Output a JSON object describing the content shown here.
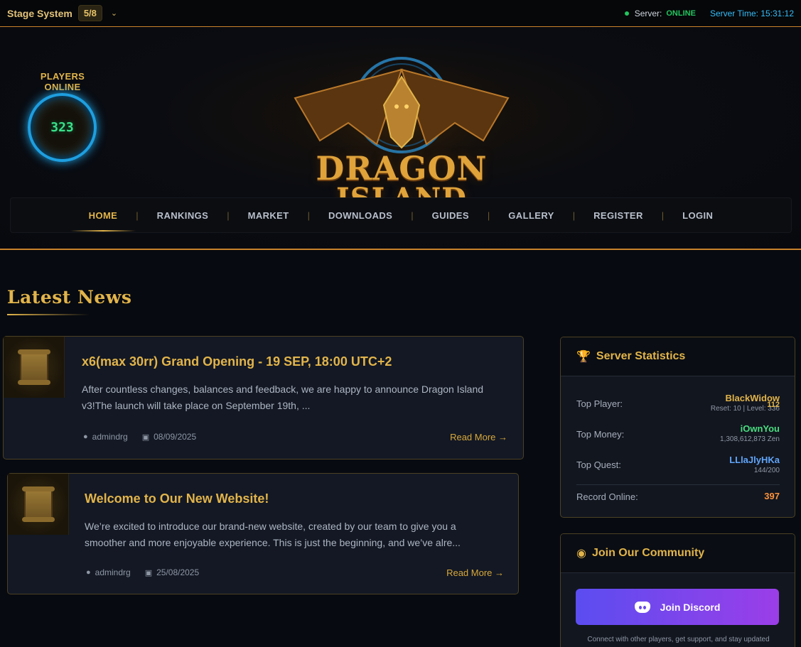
{
  "topbar": {
    "stage_label": "Stage System",
    "stage_value": "5/8",
    "server_label": "Server:",
    "server_status": "ONLINE",
    "server_time": "Server Time: 15:31:12"
  },
  "header": {
    "players_online_label": "PLAYERS ONLINE",
    "players_online_count": "323",
    "logo_line1": "DRAGON",
    "logo_line2": "ISLAND"
  },
  "nav": {
    "items": [
      "HOME",
      "RANKINGS",
      "MARKET",
      "DOWNLOADS",
      "GUIDES",
      "GALLERY",
      "REGISTER",
      "LOGIN"
    ],
    "active": "HOME"
  },
  "news": {
    "section_title": "Latest News",
    "items": [
      {
        "title": "x6(max 30rr) Grand Opening - 19 SEP, 18:00 UTC+2",
        "excerpt_line1": "After countless changes, balances and feedback, we are happy to announce Dragon Island",
        "excerpt_line2": "v3!The launch will take place on September 19th, ...",
        "author": "admindrg",
        "date": "08/09/2025",
        "read_more": "Read More →"
      },
      {
        "title": "Welcome to Our New Website!",
        "excerpt_line1": "We’re excited to introduce our brand-new website, created by our team to give you a",
        "excerpt_line2": "smoother and more enjoyable experience. This is just the beginning, and we’ve alre...",
        "author": "admindrg",
        "date": "25/08/2025",
        "read_more": "Read More →"
      }
    ]
  },
  "stats": {
    "title": "Server Statistics",
    "top_player_label": "Top Player:",
    "top_player_name": "BlackWidow",
    "top_player_sub": "Reset: 10 | Level: 336",
    "top_player_extra": "112",
    "top_money_label": "Top Money:",
    "top_money_name": "iOwnYou",
    "top_money_sub": "1,308,612,873 Zen",
    "top_quest_label": "Top Quest:",
    "top_quest_name": "LLlaJlyHKa",
    "top_quest_sub": "144/200",
    "record_label": "Record Online:",
    "record_value": "397"
  },
  "community": {
    "title": "Join Our Community",
    "button_label": "Join Discord",
    "note": "Connect with other players, get support, and stay updated"
  },
  "colors": {
    "accent_gold": "#e2b44a",
    "online_green": "#22c55e",
    "time_blue": "#38bdf8",
    "money_green": "#4ade80",
    "quest_blue": "#60a5fa",
    "record_orange": "#fb923c"
  },
  "icons": {
    "status": "status-dot-icon",
    "chevron": "chevron-down-icon",
    "author": "user-icon",
    "date": "calendar-icon",
    "stats": "trophy-icon",
    "community": "discord-icon"
  }
}
